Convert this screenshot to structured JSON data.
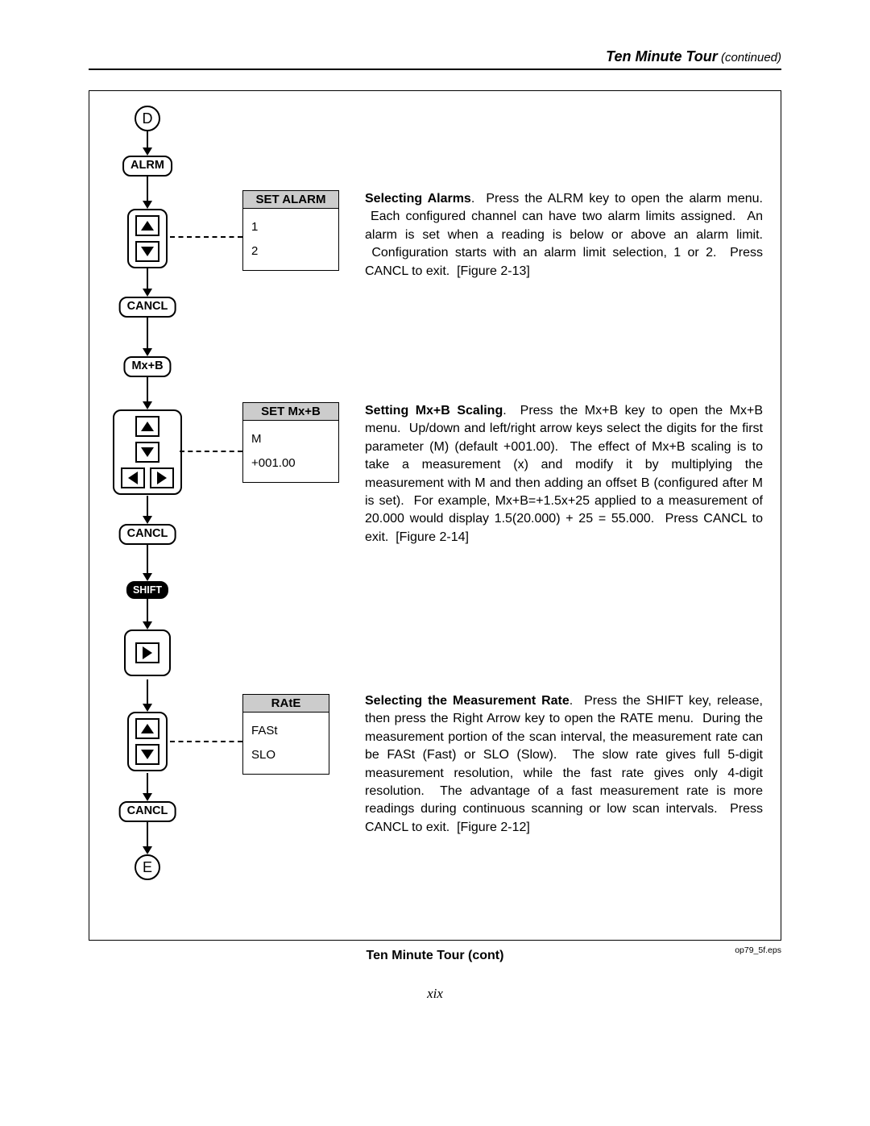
{
  "header": {
    "title": "Ten Minute Tour",
    "cont": " (continued)"
  },
  "flow": {
    "start": "D",
    "end": "E",
    "keys": {
      "alrm": "ALRM",
      "cancl": "CANCL",
      "mxb": "Mx+B",
      "shift": "SHIFT"
    }
  },
  "menus": {
    "alarm": {
      "head": "SET ALARM",
      "opt1": "1",
      "opt2": "2"
    },
    "mxb": {
      "head": "SET Mx+B",
      "line1": "M",
      "line2": "+001.00"
    },
    "rate": {
      "head": "RAtE",
      "opt1": "FASt",
      "opt2": "SLO"
    }
  },
  "desc": {
    "alarms": "Selecting Alarms.  Press the ALRM key to open the alarm menu.  Each configured channel can have two alarm limits assigned.  An alarm is set when a reading is below or above an alarm limit.  Configuration starts with an alarm limit selection, 1 or 2.  Press CANCL to exit.  [Figure 2-13]",
    "mxb": "Setting Mx+B Scaling.  Press the Mx+B key to open the Mx+B menu.  Up/down and left/right arrow keys select the digits for the first parameter (M) (default +001.00).  The effect of Mx+B scaling is to take a measurement (x) and modify it by multiplying the measurement with M and then adding an offset B (configured after M is set).  For example, Mx+B=+1.5x+25 applied to a measurement of 20.000 would display 1.5(20.000) + 25 = 55.000.  Press CANCL to exit.  [Figure 2-14]",
    "rate": "Selecting the Measurement Rate.  Press the SHIFT key, release, then press the Right Arrow key to open the RATE menu.  During the measurement portion of the scan interval, the measurement rate can be FASt (Fast) or SLO (Slow).  The slow rate gives full 5-digit measurement resolution, while the fast rate gives only 4-digit resolution.  The advantage of a fast measurement rate is more readings during continuous scanning or low scan intervals.  Press CANCL to exit.  [Figure 2-12]"
  },
  "desc_bold": {
    "alarms": "Selecting Alarms",
    "mxb": "Setting Mx+B Scaling",
    "rate": "Selecting the Measurement Rate"
  },
  "figure_eps": "op79_5f.eps",
  "caption": "Ten Minute Tour (cont)",
  "pagenum": "xix"
}
